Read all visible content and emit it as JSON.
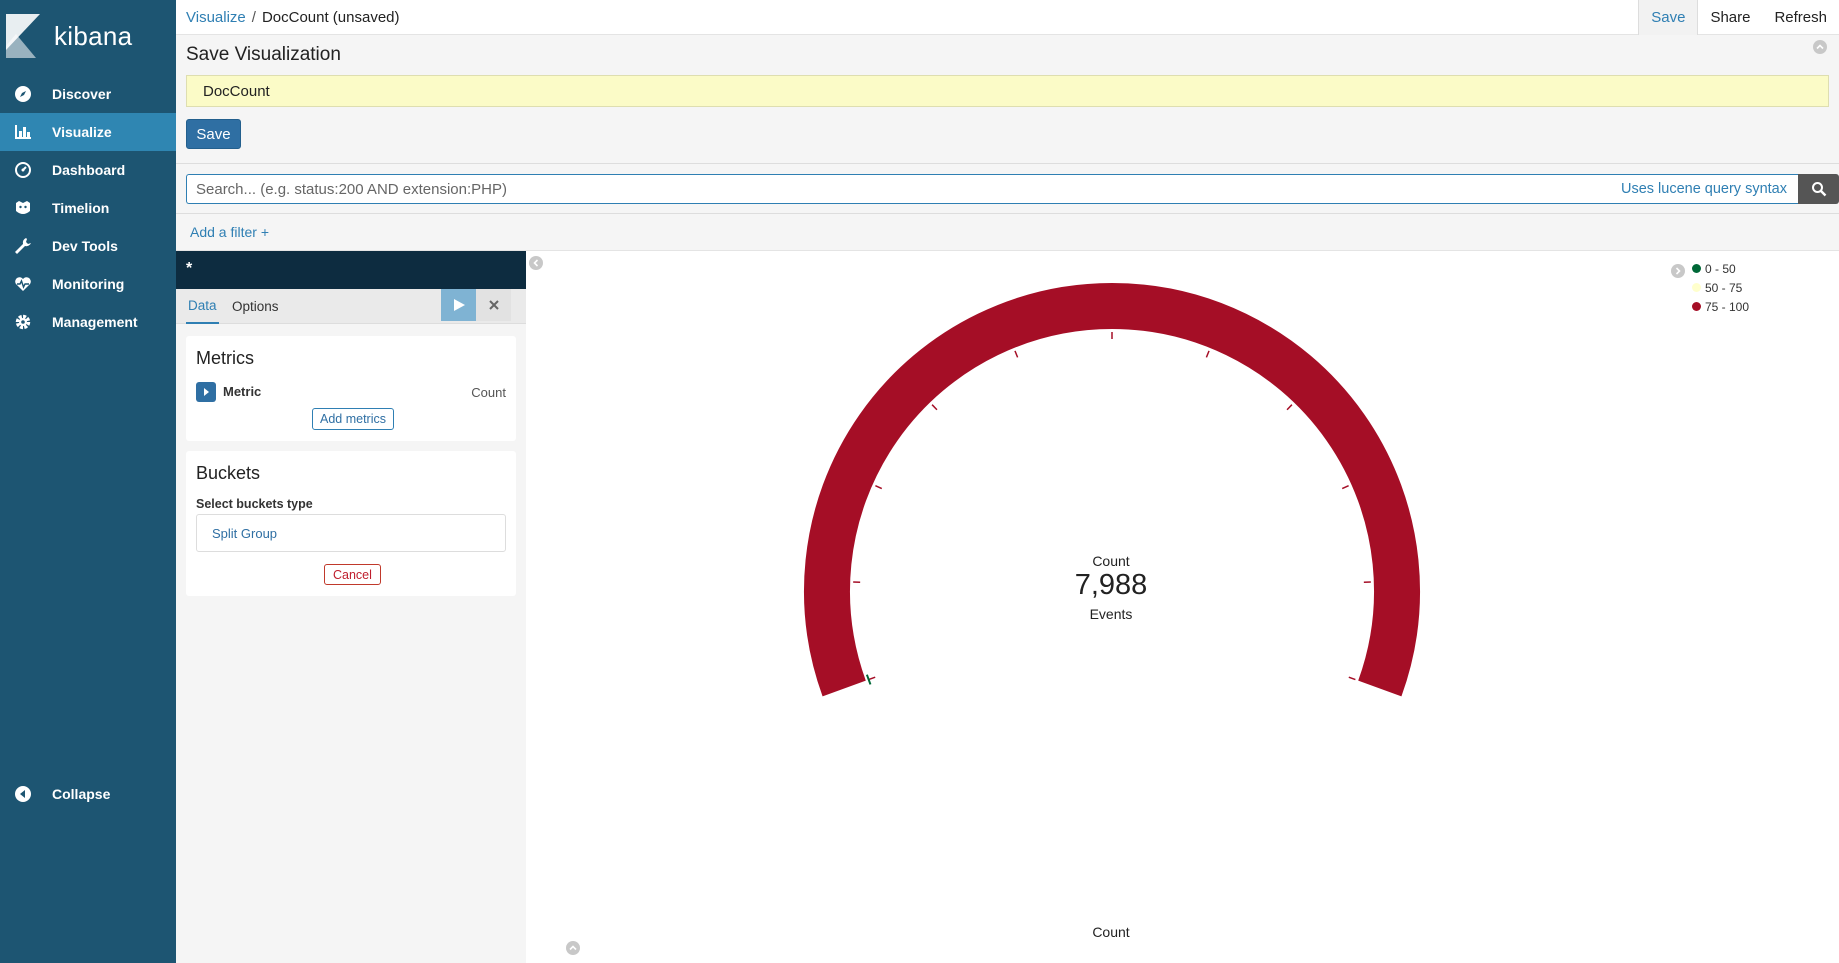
{
  "sidebar": {
    "logo_text": "kibana",
    "items": [
      {
        "label": "Discover",
        "icon": "compass-icon"
      },
      {
        "label": "Visualize",
        "icon": "bar-chart-icon"
      },
      {
        "label": "Dashboard",
        "icon": "dashboard-icon"
      },
      {
        "label": "Timelion",
        "icon": "timelion-icon"
      },
      {
        "label": "Dev Tools",
        "icon": "wrench-icon"
      },
      {
        "label": "Monitoring",
        "icon": "heartbeat-icon"
      },
      {
        "label": "Management",
        "icon": "gear-icon"
      }
    ],
    "active_item": "Visualize",
    "collapse_label": "Collapse"
  },
  "topbar": {
    "breadcrumb_root": "Visualize",
    "breadcrumb_sep": "/",
    "breadcrumb_current": "DocCount (unsaved)",
    "save_label": "Save",
    "share_label": "Share",
    "refresh_label": "Refresh"
  },
  "save_panel": {
    "title": "Save Visualization",
    "input_value": "DocCount",
    "save_button": "Save"
  },
  "search": {
    "placeholder": "Search... (e.g. status:200 AND extension:PHP)",
    "syntax_link": "Uses lucene query syntax"
  },
  "filter": {
    "add_filter": "Add a filter +"
  },
  "editor": {
    "index_pattern": "*",
    "tabs": [
      "Data",
      "Options"
    ],
    "metrics_title": "Metrics",
    "metric_label": "Metric",
    "metric_value": "Count",
    "add_metrics": "Add metrics",
    "buckets_title": "Buckets",
    "select_label": "Select buckets type",
    "bucket_option": "Split Group",
    "cancel": "Cancel"
  },
  "gauge": {
    "label": "Count",
    "value_text": "7,988",
    "sub_label": "Events",
    "bottom_label": "Count",
    "value": 7988,
    "color": "#a50e26",
    "legend": [
      {
        "label": "0 - 50",
        "color": "#006837"
      },
      {
        "label": "50 - 75",
        "color": "#ffffcc"
      },
      {
        "label": "75 - 100",
        "color": "#a50e26"
      }
    ]
  }
}
